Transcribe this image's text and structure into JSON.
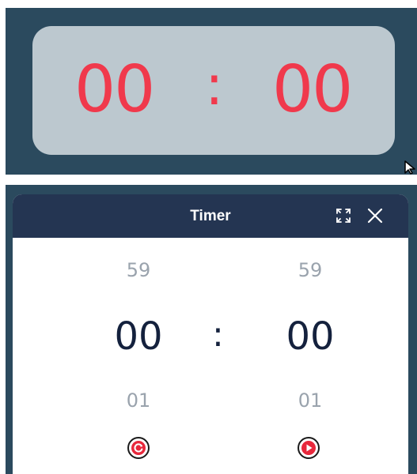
{
  "display": {
    "minutes": "00",
    "separator": ":",
    "seconds": "00",
    "digit_color": "#f0394c"
  },
  "dialog": {
    "title": "Timer",
    "icons": [
      "fullscreen-icon",
      "close-icon",
      "reset-icon",
      "play-icon"
    ],
    "minutes": {
      "previous": "59",
      "current": "00",
      "next": "01"
    },
    "separator": ":",
    "seconds": {
      "previous": "59",
      "current": "00",
      "next": "01"
    },
    "accent_color": "#e8283c",
    "header_color": "#243552"
  }
}
